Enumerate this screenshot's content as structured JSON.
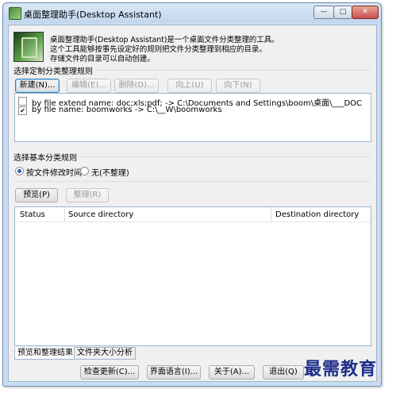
{
  "window": {
    "title": "桌面整理助手(Desktop Assistant)",
    "controls": {
      "minimize": "—",
      "maximize": "□",
      "close": "✕"
    }
  },
  "description": {
    "line1": "桌面整理助手(Desktop Assistant)是一个桌面文件分类整理的工具。",
    "line2": "这个工具能够按事先设定好的规则把文件分类整理到相应的目录。",
    "line3": "存储文件的目录可以自动创建。"
  },
  "custom_rules": {
    "label": "选择定制分类整理规则",
    "buttons": {
      "new": "新建(N)...",
      "edit": "编辑(E)...",
      "delete": "删除(D)...",
      "up": "向上(U)",
      "down": "向下(N)"
    },
    "items": [
      {
        "checked": false,
        "text": "by file extend name: doc;xls;pdf; -> C:\\Documents and Settings\\boom\\桌面\\___DOC"
      },
      {
        "checked": true,
        "text": "by file name: boomworks -> C:\\__W\\boomworks"
      }
    ]
  },
  "basic_rules": {
    "label": "选择基本分类规则",
    "options": [
      {
        "label": "按文件修改时间",
        "selected": true
      },
      {
        "label": "无(不整理)",
        "selected": false
      }
    ]
  },
  "actions": {
    "preview": "预览(P)",
    "organize": "整理(R)"
  },
  "results_table": {
    "columns": [
      "Status",
      "Source directory",
      "Destination directory"
    ]
  },
  "tabs": [
    {
      "label": "预览和整理结果",
      "active": true
    },
    {
      "label": "文件夹大小分析",
      "active": false
    }
  ],
  "footer": {
    "check_update": "检查更新(C)...",
    "language": "界面语言(I)...",
    "about": "关于(A)...",
    "exit": "退出(Q)"
  },
  "watermark": "最需教育",
  "colors": {
    "title_bar": "#c2d6ee",
    "client_bg": "#f0f0f0",
    "watermark": "#1e2d8a"
  }
}
